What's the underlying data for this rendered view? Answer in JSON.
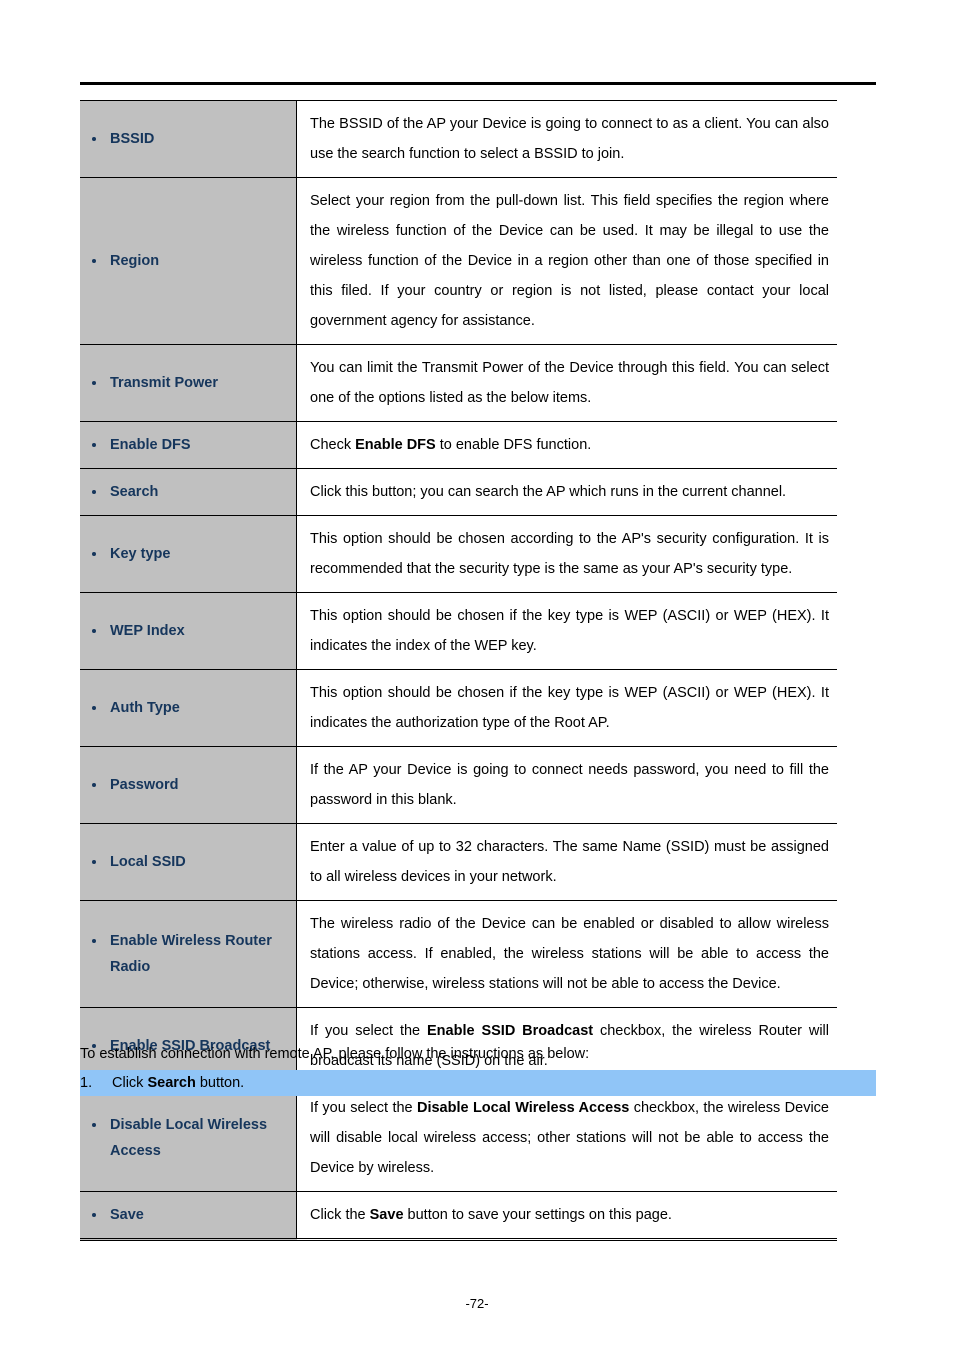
{
  "page": {
    "footer_page_number": "-72-"
  },
  "colors": {
    "label_text": "#16365c",
    "label_background": "#c0c0c0",
    "highlight": "#90c5f7",
    "rule": "#000000"
  },
  "table": {
    "rows": [
      {
        "label": "BSSID",
        "label_line2": "",
        "description_html": "The BSSID of the AP your Device is going to connect to as a client. You can also use the search function to select a BSSID to join."
      },
      {
        "label": "Region",
        "label_line2": "",
        "description_html": "Select your region from the pull-down list. This field specifies the region where the wireless function of the Device can be used. It may be illegal to use the wireless function of the Device in a region other than one of those specified in this filed. If your country or region is not listed, please contact your local government agency for assistance."
      },
      {
        "label": "Transmit Power",
        "label_line2": "",
        "description_html": "You can limit the Transmit Power of the Device through this field. You can select one of the options listed as the below items."
      },
      {
        "label": "Enable DFS",
        "label_line2": "",
        "description_html": "Check <b>Enable DFS</b> to enable DFS function."
      },
      {
        "label": "Search",
        "label_line2": "",
        "description_html": "Click this button; you can search the AP which runs in the current channel."
      },
      {
        "label": "Key type",
        "label_line2": "",
        "description_html": "This option should be chosen according to the AP's security configuration. It is recommended that the security type is the same as your AP's security type."
      },
      {
        "label": "WEP Index",
        "label_line2": "",
        "description_html": "This option should be chosen if the key type is WEP (ASCII) or WEP (HEX). It indicates the index of the WEP key."
      },
      {
        "label": "Auth Type",
        "label_line2": "",
        "description_html": "This option should be chosen if the key type is WEP (ASCII) or WEP (HEX). It indicates the authorization type of the Root AP."
      },
      {
        "label": "Password",
        "label_line2": "",
        "description_html": "If the AP your Device is going to connect needs password, you need to fill the password in this blank."
      },
      {
        "label": "Local SSID",
        "label_line2": "",
        "description_html": "Enter a value of up to 32 characters. The same Name (SSID) must be assigned to all wireless devices in your network."
      },
      {
        "label": "Enable Wireless Router",
        "label_line2": "Radio",
        "description_html": "The wireless radio of the Device can be enabled or disabled to allow wireless stations access. If enabled, the wireless stations will be able to access the Device; otherwise, wireless stations will not be able to access the Device."
      },
      {
        "label": "Enable SSID Broadcast",
        "label_line2": "",
        "description_html": "If you select the <b>Enable SSID Broadcast</b> checkbox, the wireless Router will broadcast its name (SSID) on the air."
      },
      {
        "label": "Disable Local Wireless",
        "label_line2": "Access",
        "description_html": "If you select the <b>Disable Local Wireless Access</b> checkbox, the wireless Device will disable local wireless access; other stations will not be able to access the Device by wireless."
      },
      {
        "label": "Save",
        "label_line2": "",
        "description_html": "Click the <b>Save</b> button to save your settings on this page."
      }
    ]
  },
  "body": {
    "intro": "To establish connection with remote AP, please follow the instructions as below:",
    "step": {
      "number": "1.",
      "text_html": "Click <b>Search</b> button."
    }
  }
}
